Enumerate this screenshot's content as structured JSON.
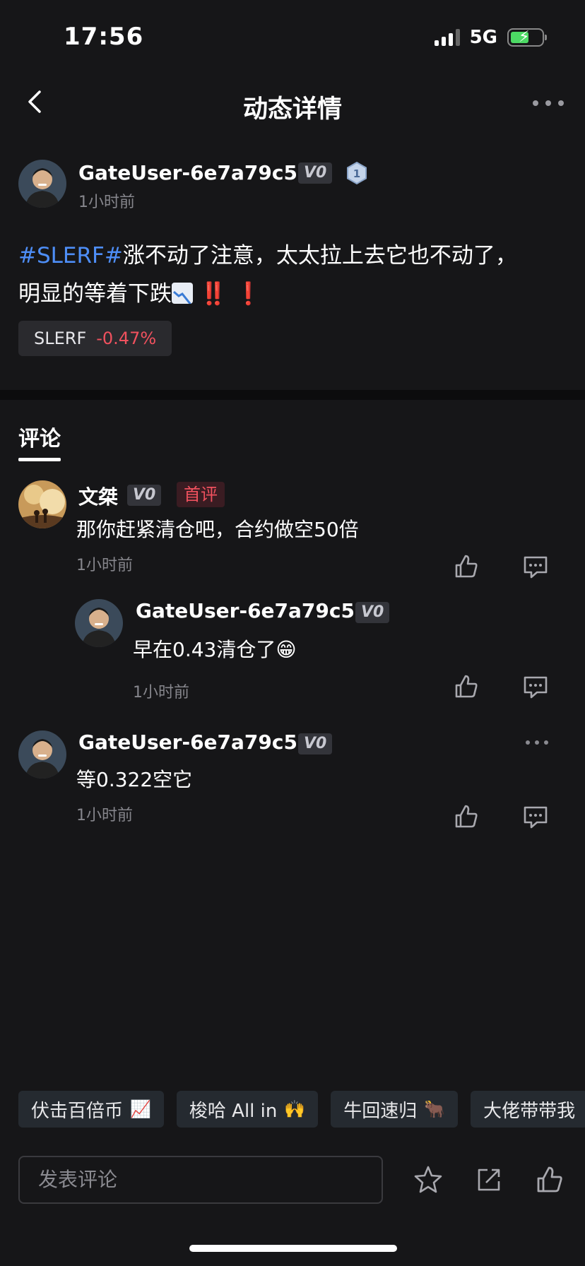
{
  "status_bar": {
    "time": "17:56",
    "network": "5G"
  },
  "header": {
    "title": "动态详情"
  },
  "post": {
    "author": "GateUser-6e7a79c5",
    "vip_badge": "V0",
    "level_badge": "1",
    "time": "1小时前",
    "text_tag": "#SLERF#",
    "text_line1": "涨不动了注意，太太拉上去它也不动了，",
    "text_line2": "明显的等着下跌",
    "text_marks": "‼️ ❗",
    "ticker": {
      "symbol": "SLERF",
      "change": "-0.47%"
    }
  },
  "comments_tab": "评论",
  "comments": [
    {
      "author": "文桀",
      "vip_badge": "V0",
      "first_badge": "首评",
      "text": "那你赶紧清仓吧，合约做空50倍",
      "time": "1小时前",
      "reply": {
        "author": "GateUser-6e7a79c5",
        "vip_badge": "V0",
        "text": "早在0.43清仓了",
        "emoji": "😁",
        "time": "1小时前"
      }
    },
    {
      "author": "GateUser-6e7a79c5",
      "vip_badge": "V0",
      "text": "等0.322空它",
      "time": "1小时前"
    }
  ],
  "chips": [
    {
      "label": "伏击百倍币",
      "emoji": "📈"
    },
    {
      "label": "梭哈 All in",
      "emoji": "🙌"
    },
    {
      "label": "牛回速归",
      "emoji": "🐂"
    },
    {
      "label": "大佬带带我",
      "emoji": ""
    }
  ],
  "composer": {
    "placeholder": "发表评论"
  },
  "icons": {
    "back": "chevron-left-icon",
    "more": "more-horizontal-icon",
    "like": "thumbs-up-icon",
    "reply": "comment-icon",
    "star": "star-icon",
    "share": "share-icon"
  }
}
